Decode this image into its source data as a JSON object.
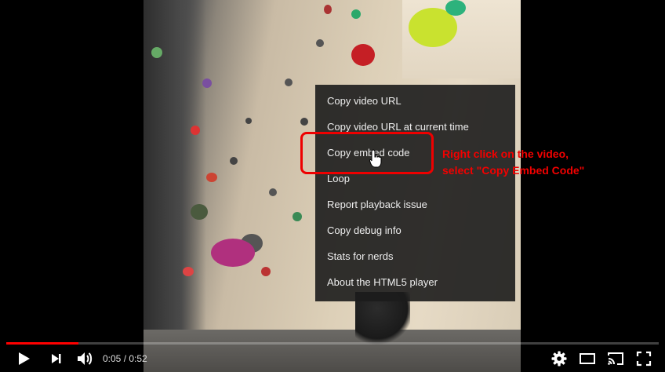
{
  "player": {
    "menu_items": [
      {
        "label": "Copy video URL"
      },
      {
        "label": "Copy video URL at current time"
      },
      {
        "label": "Copy embed code"
      },
      {
        "label": "Loop"
      },
      {
        "label": "Report playback issue"
      },
      {
        "label": "Copy debug info"
      },
      {
        "label": "Stats for nerds"
      },
      {
        "label": "About the HTML5 player"
      }
    ],
    "annotation": {
      "line1": "Right click on the video,",
      "line2": "select \"Copy Embed Code\""
    },
    "current_time": "0:05",
    "separator": " / ",
    "duration": "0:52",
    "progress_fraction": 0.11,
    "icons": {
      "play": "play-icon",
      "next": "next-icon",
      "volume": "volume-icon",
      "settings": "gear-icon",
      "theater": "theater-mode-icon",
      "cast": "cast-icon",
      "fullscreen": "fullscreen-icon"
    },
    "colors": {
      "accent": "#ff0000",
      "annotation": "#f20000",
      "menu_bg": "#1c1c1c"
    }
  }
}
